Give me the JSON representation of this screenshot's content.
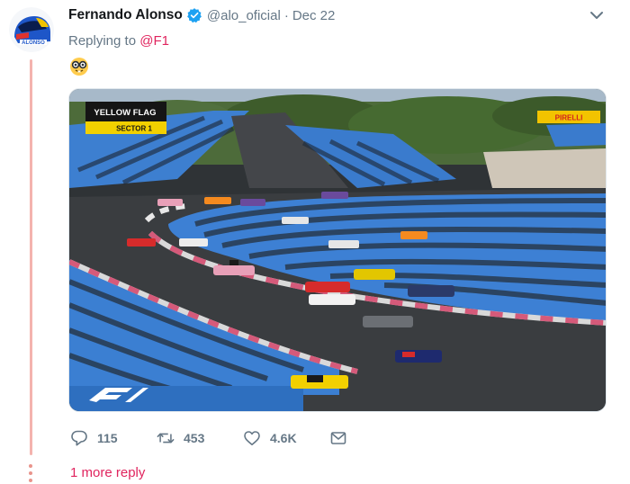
{
  "tweet": {
    "author_name": "Fernando Alonso",
    "verified_icon": "verified-badge-icon",
    "handle": "@alo_oficial",
    "separator": "·",
    "date": "Dec 22",
    "replying_prefix": "Replying to ",
    "replying_to": "@F1",
    "text_emoji_icon": "nerd-face-emoji-icon",
    "more_options_icon": "chevron-down-icon"
  },
  "avatar": {
    "image": "helmet-avatar",
    "label": "ALONSO"
  },
  "media": {
    "description_icon": "race-photo",
    "overlay_flag": "YELLOW FLAG",
    "overlay_sector": "SECTOR 1",
    "sponsor_board": "PIRELLI"
  },
  "actions": {
    "reply_count": "115",
    "retweet_count": "453",
    "like_count": "4.6K",
    "reply_icon": "reply-icon",
    "retweet_icon": "retweet-icon",
    "like_icon": "heart-icon",
    "dm_icon": "envelope-icon"
  },
  "more_replies_label": "1 more reply",
  "colors": {
    "accent_red": "#e0245e",
    "text_gray": "#657786",
    "verified_blue": "#1da1f2",
    "thread_line": "#f4b3ae"
  }
}
